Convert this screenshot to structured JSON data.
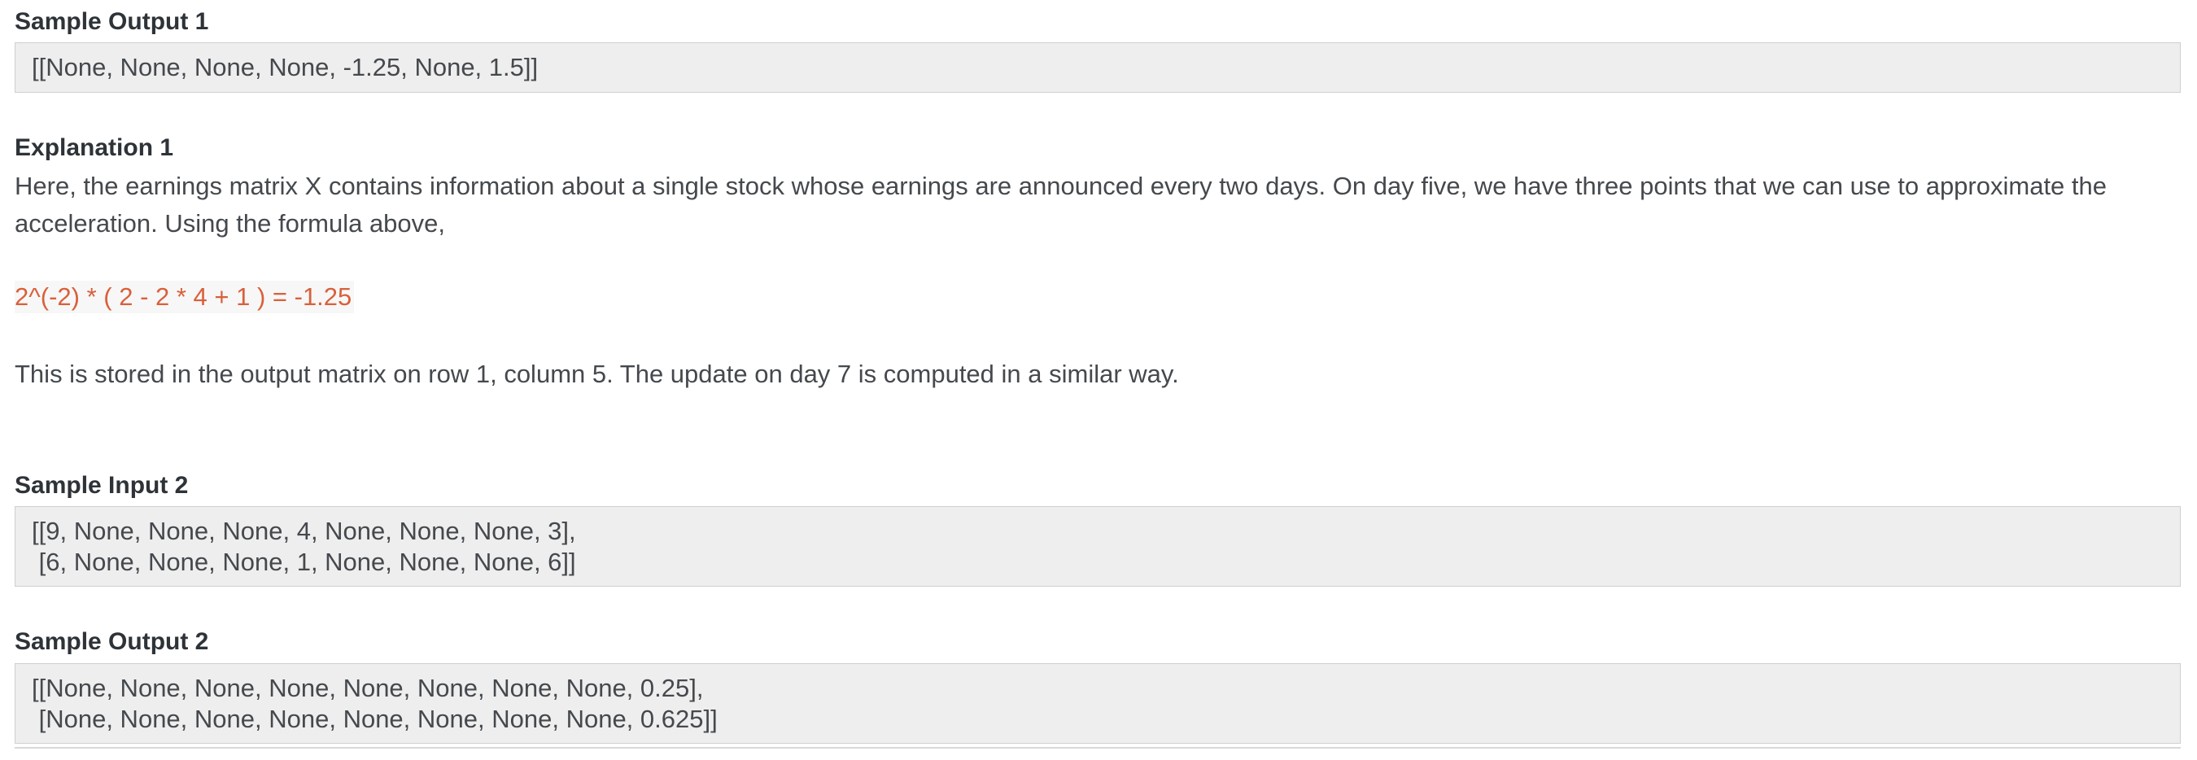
{
  "sample_output_1": {
    "heading": "Sample Output 1",
    "lines": [
      "[[None, None, None, None, -1.25, None, 1.5]]"
    ]
  },
  "explanation_1": {
    "heading": "Explanation 1",
    "paragraph": "Here, the earnings matrix X contains information about a single stock whose earnings are announced every two days. On day five, we have three points that we can use to approximate the acceleration. Using the formula above,",
    "formula": "2^(-2) * ( 2 - 2 * 4 + 1 ) = -1.25",
    "note": "This is stored in the output matrix on row 1, column 5. The update on day 7 is computed in a similar way."
  },
  "sample_input_2": {
    "heading": "Sample Input 2",
    "lines": [
      "[[9, None, None, None, 4, None, None, None, 3],",
      " [6, None, None, None, 1, None, None, None, 6]]"
    ]
  },
  "sample_output_2": {
    "heading": "Sample Output 2",
    "lines": [
      "[[None, None, None, None, None, None, None, None, 0.25],",
      " [None, None, None, None, None, None, None, None, 0.625]]"
    ]
  }
}
